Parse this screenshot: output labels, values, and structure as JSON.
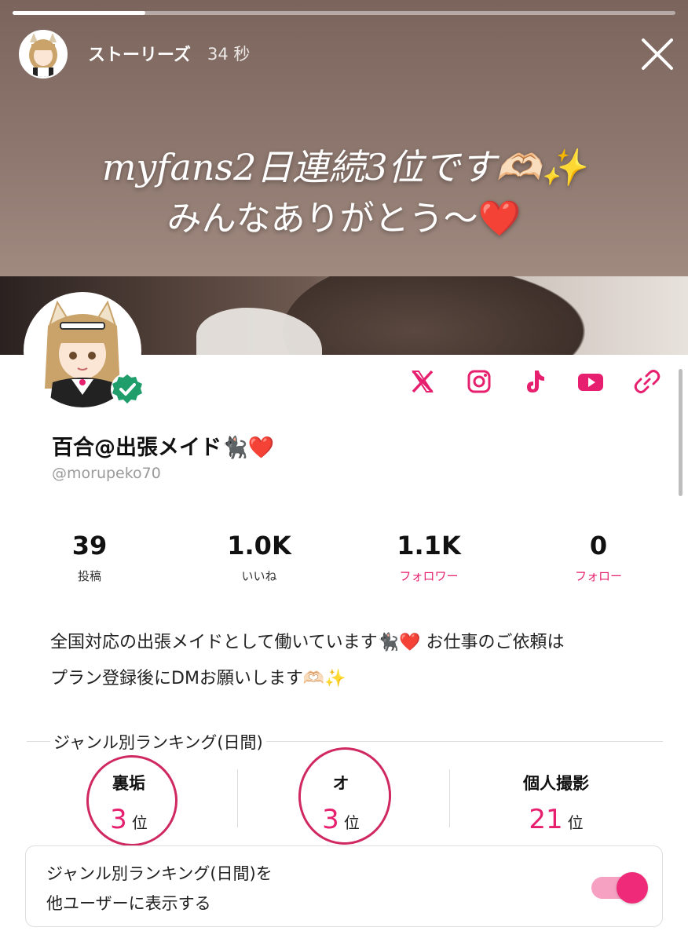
{
  "story": {
    "username": "ストーリーズ",
    "time": "34 秒",
    "caption_line1": "myfans2日連続3位です🫶🏻✨",
    "caption_line2": "みんなありがとう〜❤️"
  },
  "profile": {
    "display_name": "百合@出張メイド🐈‍⬛❤️",
    "handle": "@morupeko70",
    "verified": true
  },
  "socials": [
    "x-icon",
    "instagram-icon",
    "tiktok-icon",
    "youtube-icon",
    "link-icon"
  ],
  "stats": [
    {
      "value": "39",
      "label": "投稿"
    },
    {
      "value": "1.0K",
      "label": "いいね"
    },
    {
      "value": "1.1K",
      "label": "フォロワー"
    },
    {
      "value": "0",
      "label": "フォロー"
    }
  ],
  "bio": {
    "line1": "全国対応の出張メイドとして働いています🐈‍⬛❤️ お仕事のご依頼は",
    "line2": "プラン登録後にDMお願いします🫶🏻✨"
  },
  "ranking": {
    "title": "ジャンル別ランキング(日間)",
    "suffix": "位",
    "items": [
      {
        "genre": "裏垢",
        "rank": "3"
      },
      {
        "genre": "オ",
        "rank": "3"
      },
      {
        "genre": "個人撮影",
        "rank": "21"
      }
    ]
  },
  "setting": {
    "line1": "ジャンル別ランキング(日間)を",
    "line2": "他ユーザーに表示する",
    "toggle_on": true
  },
  "colors": {
    "accent": "#e6206e",
    "annotation": "#d02860"
  },
  "story_progress": 0.2
}
